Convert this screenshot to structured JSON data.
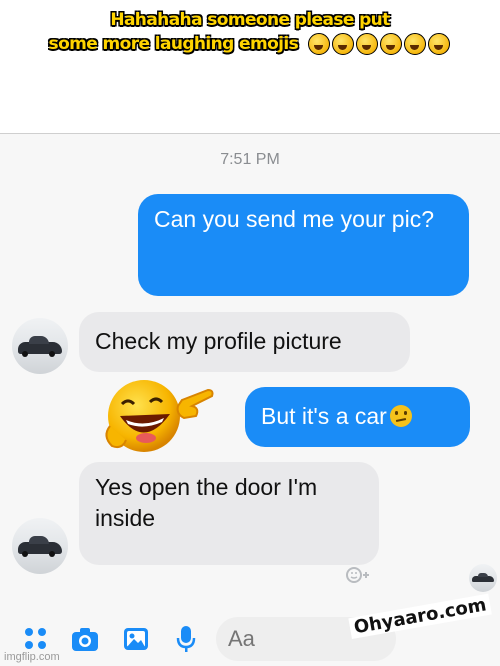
{
  "caption": {
    "line1": "Hahahaha someone please put",
    "line2": "some more laughing emojis",
    "emojis": [
      "rolling-laughing-icon",
      "rolling-laughing-icon",
      "grinning-sweat-icon",
      "rolling-laughing-icon",
      "grinning-sweat-icon",
      "rolling-laughing-icon"
    ]
  },
  "chat": {
    "timestamp": "7:51 PM",
    "messages": [
      {
        "sender": "me",
        "text": "Can you send me your pic?"
      },
      {
        "sender": "them",
        "text": "Check my profile picture"
      },
      {
        "sender": "me",
        "text": "But it's a car",
        "emoji": "confused-face-icon"
      },
      {
        "sender": "them",
        "text": "Yes open the door I'm inside"
      }
    ],
    "colors": {
      "outgoing": "#1a8cf7",
      "incoming": "#e9e9eb"
    }
  },
  "composer": {
    "placeholder": "Aa",
    "icons": [
      "apps-icon",
      "camera-icon",
      "photo-icon",
      "microphone-icon"
    ]
  },
  "watermark": "Ohyaaro.com",
  "imgflip": "imgflip.com"
}
